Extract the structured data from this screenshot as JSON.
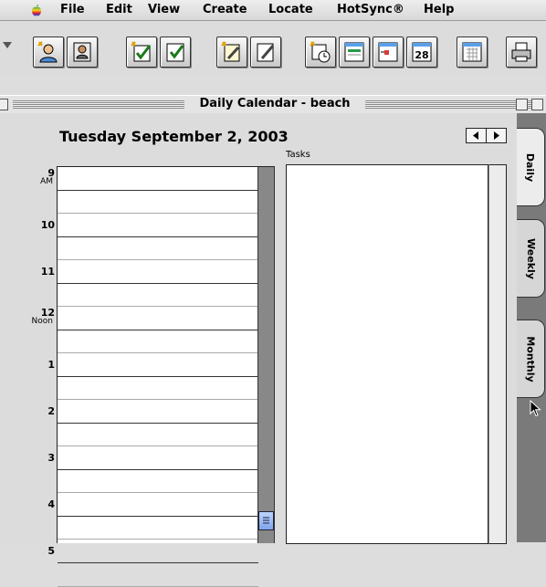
{
  "menubar": {
    "apple_icon": "apple-logo",
    "items": [
      "File",
      "Edit",
      "View",
      "Create",
      "Locate",
      "HotSync®",
      "Help"
    ]
  },
  "toolbar": {
    "buttons": [
      {
        "name": "new-contact-icon"
      },
      {
        "name": "address-book-icon"
      },
      {
        "name": "new-task-icon"
      },
      {
        "name": "task-list-icon"
      },
      {
        "name": "new-memo-icon"
      },
      {
        "name": "memo-list-icon"
      },
      {
        "name": "new-event-icon"
      },
      {
        "name": "day-view-icon"
      },
      {
        "name": "week-view-icon"
      },
      {
        "name": "month-view-icon"
      },
      {
        "name": "year-view-icon"
      },
      {
        "name": "print-icon"
      }
    ],
    "month_view_number": "28"
  },
  "window": {
    "title": "Daily Calendar - beach"
  },
  "calendar": {
    "date_title": "Tuesday September 2, 2003",
    "tasks_label": "Tasks",
    "hours": [
      {
        "label": "9",
        "sub": "AM"
      },
      {
        "label": "10",
        "sub": ""
      },
      {
        "label": "11",
        "sub": ""
      },
      {
        "label": "12",
        "sub": "Noon"
      },
      {
        "label": "1",
        "sub": ""
      },
      {
        "label": "2",
        "sub": ""
      },
      {
        "label": "3",
        "sub": ""
      },
      {
        "label": "4",
        "sub": ""
      },
      {
        "label": "5",
        "sub": ""
      }
    ]
  },
  "tabs": {
    "daily": "Daily",
    "weekly": "Weekly",
    "monthly": "Monthly"
  },
  "colors": {
    "scroll_thumb": "#8fb0f2",
    "tab_strip": "#7a7a7a"
  }
}
